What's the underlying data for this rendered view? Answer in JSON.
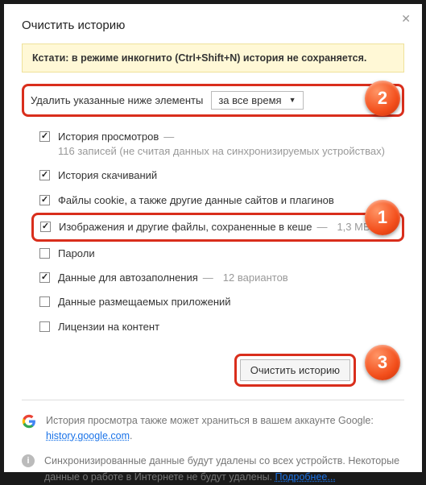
{
  "title": "Очистить историю",
  "banner": "Кстати: в режиме инкогнито (Ctrl+Shift+N) история не сохраняется.",
  "time_row": {
    "label": "Удалить указанные ниже элементы",
    "selected": "за все время"
  },
  "options": {
    "history": {
      "label": "История просмотров",
      "desc": "116 записей (не считая данных на синхронизируемых устройствах)"
    },
    "downloads": {
      "label": "История скачиваний"
    },
    "cookies": {
      "label": "Файлы cookie, а также другие данные сайтов и плагинов"
    },
    "cache": {
      "label": "Изображения и другие файлы, сохраненные в кеше",
      "desc": "1,3 МБ"
    },
    "passwords": {
      "label": "Пароли"
    },
    "autofill": {
      "label": "Данные для автозаполнения",
      "desc": "12 вариантов"
    },
    "hosted": {
      "label": "Данные размещаемых приложений"
    },
    "licenses": {
      "label": "Лицензии на контент"
    }
  },
  "clear_button": "Очистить историю",
  "footer": {
    "google_note": "История просмотра также может храниться в вашем аккаунте Google: ",
    "google_link": "history.google.com",
    "sync_note": "Синхронизированные данные будут удалены со всех устройств. Некоторые данные о работе в Интернете не будут удалены. ",
    "more_link": "Подробнее..."
  },
  "badges": {
    "one": "1",
    "two": "2",
    "three": "3"
  }
}
